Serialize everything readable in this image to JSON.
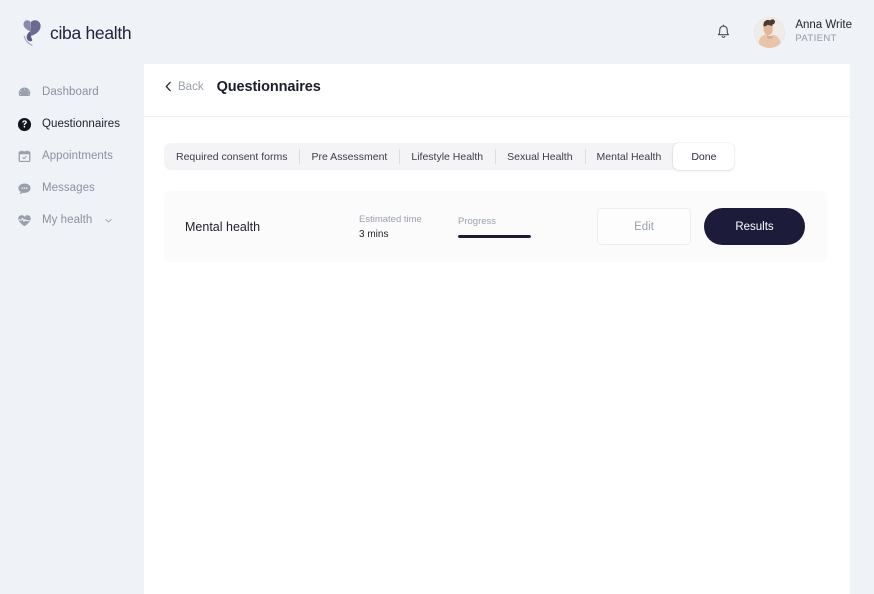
{
  "brand": {
    "name": "ciba health",
    "logo_icon": "butterfly-icon",
    "logo_color": "#6f6a8f"
  },
  "sidebar": {
    "items": [
      {
        "label": "Dashboard",
        "icon": "dashboard-icon",
        "active": false
      },
      {
        "label": "Questionnaires",
        "icon": "question-mark-icon",
        "active": true
      },
      {
        "label": "Appointments",
        "icon": "calendar-icon",
        "active": false
      },
      {
        "label": "Messages",
        "icon": "chat-bubble-icon",
        "active": false
      },
      {
        "label": "My health",
        "icon": "heart-pulse-icon",
        "active": false,
        "chevron": "chevron-down-icon"
      }
    ]
  },
  "topbar": {
    "bell_icon": "notification-bell-icon",
    "user": {
      "name": "Anna Write",
      "role": "PATIENT",
      "avatar_icon": "user-avatar-photo"
    }
  },
  "header": {
    "back_label": "Back",
    "back_icon": "chevron-left-icon",
    "title": "Questionnaires"
  },
  "tabs": [
    {
      "label": "Required consent forms",
      "active": false
    },
    {
      "label": "Pre Assessment",
      "active": false
    },
    {
      "label": "Lifestyle Health",
      "active": false
    },
    {
      "label": "Sexual Health",
      "active": false
    },
    {
      "label": "Mental Health",
      "active": false
    },
    {
      "label": "Done",
      "active": true
    }
  ],
  "card": {
    "title": "Mental health",
    "estimated_time_label": "Estimated time",
    "estimated_time_value": "3 mins",
    "progress_label": "Progress",
    "progress_percent": 100,
    "edit_label": "Edit",
    "results_label": "Results"
  },
  "colors": {
    "sidebar_bg": "#eff2f7",
    "panel_bg": "#ffffff",
    "accent_dark": "#1c1b3a",
    "tabbar_bg": "#f4f4f6",
    "card_bg": "#fbfbfc",
    "muted_text": "#9aa0aa"
  }
}
